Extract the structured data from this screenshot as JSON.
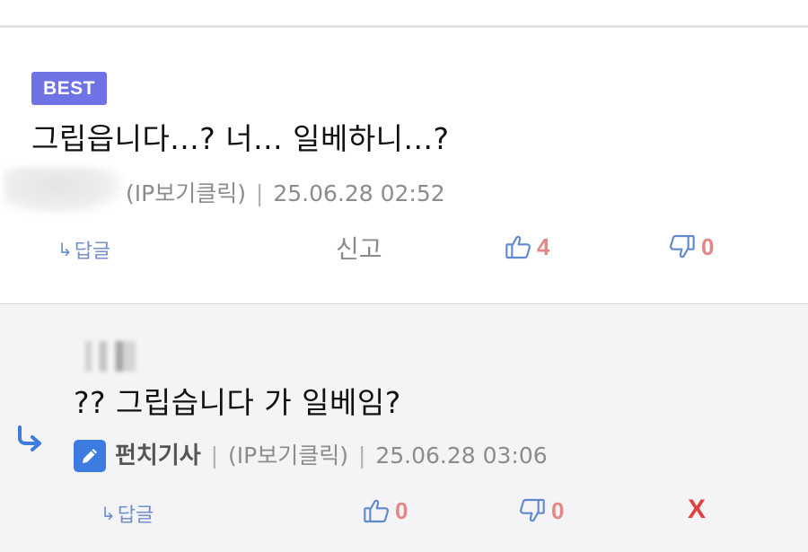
{
  "best_comment": {
    "badge": "BEST",
    "text": "그립읍니다...? 너... 일베하니...?",
    "ip_label": "(IP보기클릭)",
    "separator": "|",
    "timestamp": "25.06.28 02:52",
    "reply_label": "답글",
    "report_label": "신고",
    "likes": "4",
    "dislikes": "0"
  },
  "reply": {
    "text": "?? 그립습니다 가 일베임?",
    "author": "펀치기사",
    "ip_label": "(IP보기클릭)",
    "separator": "|",
    "timestamp": "25.06.28 03:06",
    "reply_label": "답글",
    "likes": "0",
    "dislikes": "0",
    "delete_label": "X"
  },
  "colors": {
    "badge_bg": "#6f73e6",
    "link_blue": "#6f8fcf",
    "count_red": "#e58585",
    "delete_red": "#e04040",
    "reply_bg": "#f4f4f6"
  },
  "icons": [
    "reply-arrow-icon",
    "thumbs-up-icon",
    "thumbs-down-icon",
    "pencil-icon",
    "nested-reply-icon"
  ]
}
